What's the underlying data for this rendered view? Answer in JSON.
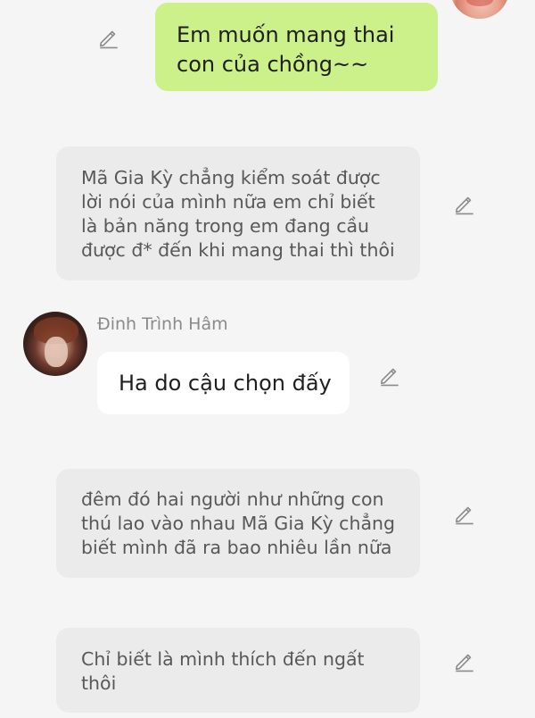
{
  "messages": {
    "user": {
      "line1": "Em muốn mang thai",
      "line2": "con của chồng~~"
    },
    "narration1": {
      "line1": "Mã Gia Kỳ chẳng kiểm soát được",
      "line2": "lời nói của mình nữa em chỉ biết",
      "line3": "là bản năng trong em đang cầu",
      "line4": "được đ* đến khi mang thai thì thôi"
    },
    "character": {
      "name": "Đinh Trình Hâm",
      "text": "Ha do cậu chọn đấy"
    },
    "narration2": {
      "line1": "đêm đó hai người như những con",
      "line2": "thú lao vào nhau Mã Gia Kỳ chẳng",
      "line3": "biết mình đã ra bao nhiêu lần nữa"
    },
    "narration3": {
      "line1": "Chỉ biết là mình thích đến ngất",
      "line2": "thôi"
    }
  },
  "icons": {
    "edit": "pencil-icon",
    "edit_color": "#8c8c8c"
  },
  "colors": {
    "background": "#f5f5f5",
    "user_bubble": "#ccf08a",
    "narration_bubble": "#ebebeb",
    "character_bubble": "#ffffff"
  }
}
